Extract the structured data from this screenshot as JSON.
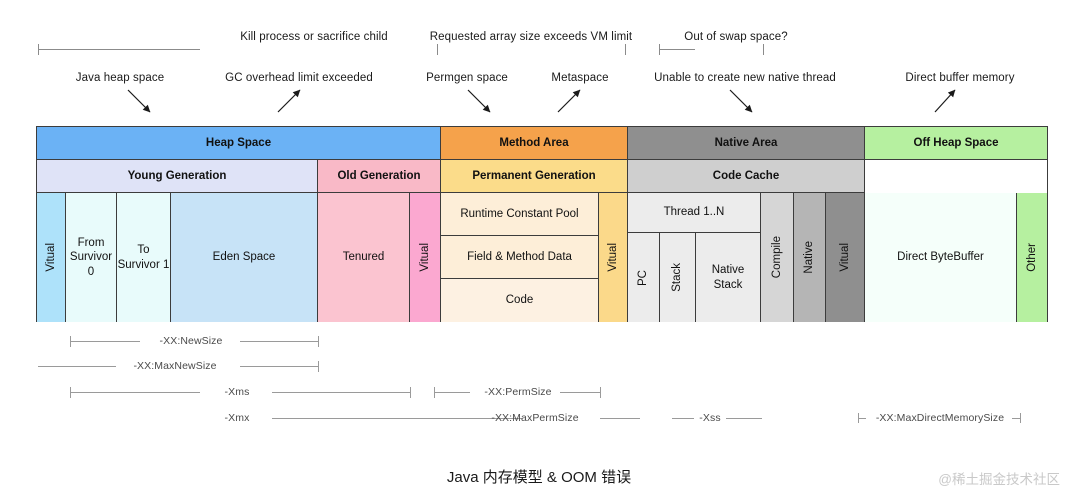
{
  "title": "Java 内存模型 & OOM 错误",
  "watermark": "@稀土掘金技术社区",
  "oom_annotations": {
    "row1": [
      {
        "text": "Kill process or sacrifice child"
      },
      {
        "text": "Requested array size exceeds VM limit"
      },
      {
        "text": "Out of swap space?"
      }
    ],
    "row2": [
      {
        "text": "Java heap space"
      },
      {
        "text": "GC overhead limit exceeded"
      },
      {
        "text": "Permgen space"
      },
      {
        "text": "Metaspace"
      },
      {
        "text": "Unable to create new native thread"
      },
      {
        "text": "Direct buffer memory"
      }
    ]
  },
  "memory_regions": {
    "row_top": [
      {
        "label": "Heap Space",
        "color": "#6bb2f5"
      },
      {
        "label": "Method Area",
        "color": "#f5a24b"
      },
      {
        "label": "Native Area",
        "color": "#8f8f8f"
      },
      {
        "label": "Off Heap Space",
        "color": "#b6f0a0"
      }
    ],
    "row_mid": [
      {
        "label": "Young Generation",
        "color": "#dfe3f7"
      },
      {
        "label": "Old Generation",
        "color": "#f9b9c7"
      },
      {
        "label": "Permanent Generation",
        "color": "#fbdc8a"
      },
      {
        "label": "Code Cache",
        "color": "#cfcfcf"
      }
    ],
    "heap_detail": [
      {
        "label": "Vitual",
        "color": "#aee2fa",
        "vertical": true
      },
      {
        "label": "From\nSurvivor 0",
        "color": "#e8fbfb",
        "vertical": false
      },
      {
        "label": "To\nSurvivor 1",
        "color": "#e8fbfb",
        "vertical": false
      },
      {
        "label": "Eden Space",
        "color": "#c7e3f7",
        "vertical": false
      },
      {
        "label": "Tenured",
        "color": "#fbc4d0",
        "vertical": false
      },
      {
        "label": "Vitual",
        "color": "#fba8d0",
        "vertical": true
      }
    ],
    "method_detail": [
      {
        "label": "Runtime Constant Pool",
        "color": "#fdeed8"
      },
      {
        "label": "Field & Method Data",
        "color": "#fdeed8"
      },
      {
        "label": "Code",
        "color": "#fdf1e2"
      }
    ],
    "method_virtual": {
      "label": "Vitual",
      "color": "#fbd98a"
    },
    "native_detail": {
      "thread_header": {
        "label": "Thread 1..N",
        "color": "#ececec"
      },
      "thread_parts": [
        {
          "label": "PC",
          "color": "#ececec",
          "vertical": true
        },
        {
          "label": "Stack",
          "color": "#ececec",
          "vertical": true
        },
        {
          "label": "Native\nStack",
          "color": "#ececec",
          "vertical": false
        }
      ],
      "others": [
        {
          "label": "Compile",
          "color": "#d6d6d6",
          "vertical": true
        },
        {
          "label": "Native",
          "color": "#b5b5b5",
          "vertical": true
        },
        {
          "label": "Vitual",
          "color": "#8f8f8f",
          "vertical": true
        }
      ]
    },
    "offheap_detail": [
      {
        "label": "Direct ByteBuffer",
        "color": "#f5fffa",
        "vertical": false
      },
      {
        "label": "Other",
        "color": "#b6f0a0",
        "vertical": true
      }
    ]
  },
  "jvm_flags": [
    {
      "label": "-XX:NewSize"
    },
    {
      "label": "-XX:MaxNewSize"
    },
    {
      "label": "-Xms"
    },
    {
      "label": "-Xmx"
    },
    {
      "label": "-XX:PermSize"
    },
    {
      "label": "-XX:MaxPermSize"
    },
    {
      "label": "-Xss"
    },
    {
      "label": "-XX:MaxDirectMemorySize"
    }
  ]
}
